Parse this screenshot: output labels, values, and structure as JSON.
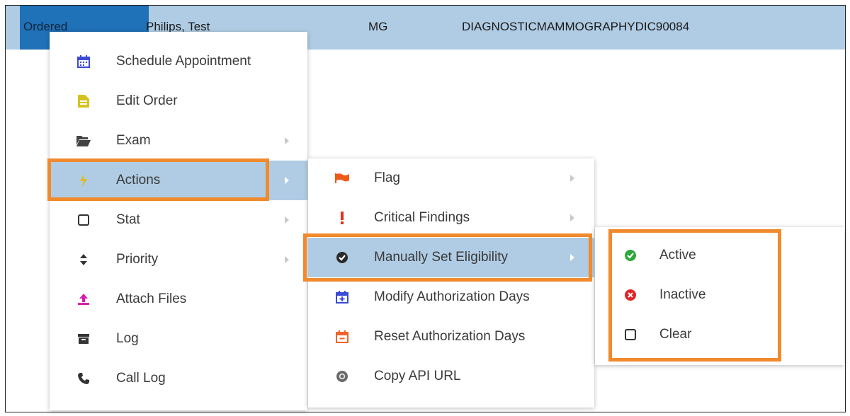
{
  "row": {
    "status": "Ordered",
    "patient": "Philips, Test",
    "modality": "MG",
    "procedure": "DIAGNOSTICMAMMOGRAPHYDIC90084"
  },
  "menu1": {
    "items": [
      {
        "label": "Schedule Appointment",
        "icon": "calendar-icon"
      },
      {
        "label": "Edit Order",
        "icon": "document-icon"
      },
      {
        "label": "Exam",
        "icon": "folder-open-icon"
      },
      {
        "label": "Actions",
        "icon": "bolt-icon"
      },
      {
        "label": "Stat",
        "icon": "checkbox-icon"
      },
      {
        "label": "Priority",
        "icon": "sort-icon"
      },
      {
        "label": "Attach Files",
        "icon": "upload-icon"
      },
      {
        "label": "Log",
        "icon": "archive-icon"
      },
      {
        "label": "Call Log",
        "icon": "phone-icon"
      }
    ]
  },
  "menu2": {
    "items": [
      {
        "label": "Flag",
        "icon": "flag-icon"
      },
      {
        "label": "Critical Findings",
        "icon": "exclamation-icon"
      },
      {
        "label": "Manually Set Eligibility",
        "icon": "check-circle-icon"
      },
      {
        "label": "Modify Authorization Days",
        "icon": "calendar-plus-icon"
      },
      {
        "label": "Reset Authorization Days",
        "icon": "calendar-minus-icon"
      },
      {
        "label": "Copy API URL",
        "icon": "chrome-icon"
      }
    ]
  },
  "menu3": {
    "items": [
      {
        "label": "Active",
        "icon": "check-circle-green-icon"
      },
      {
        "label": "Inactive",
        "icon": "x-circle-red-icon"
      },
      {
        "label": "Clear",
        "icon": "checkbox-empty-icon"
      }
    ]
  },
  "colors": {
    "row_bg": "#b0cce4",
    "status_bg": "#1f71b8",
    "highlight": "#b0cce4",
    "outline": "#f08a2c"
  }
}
